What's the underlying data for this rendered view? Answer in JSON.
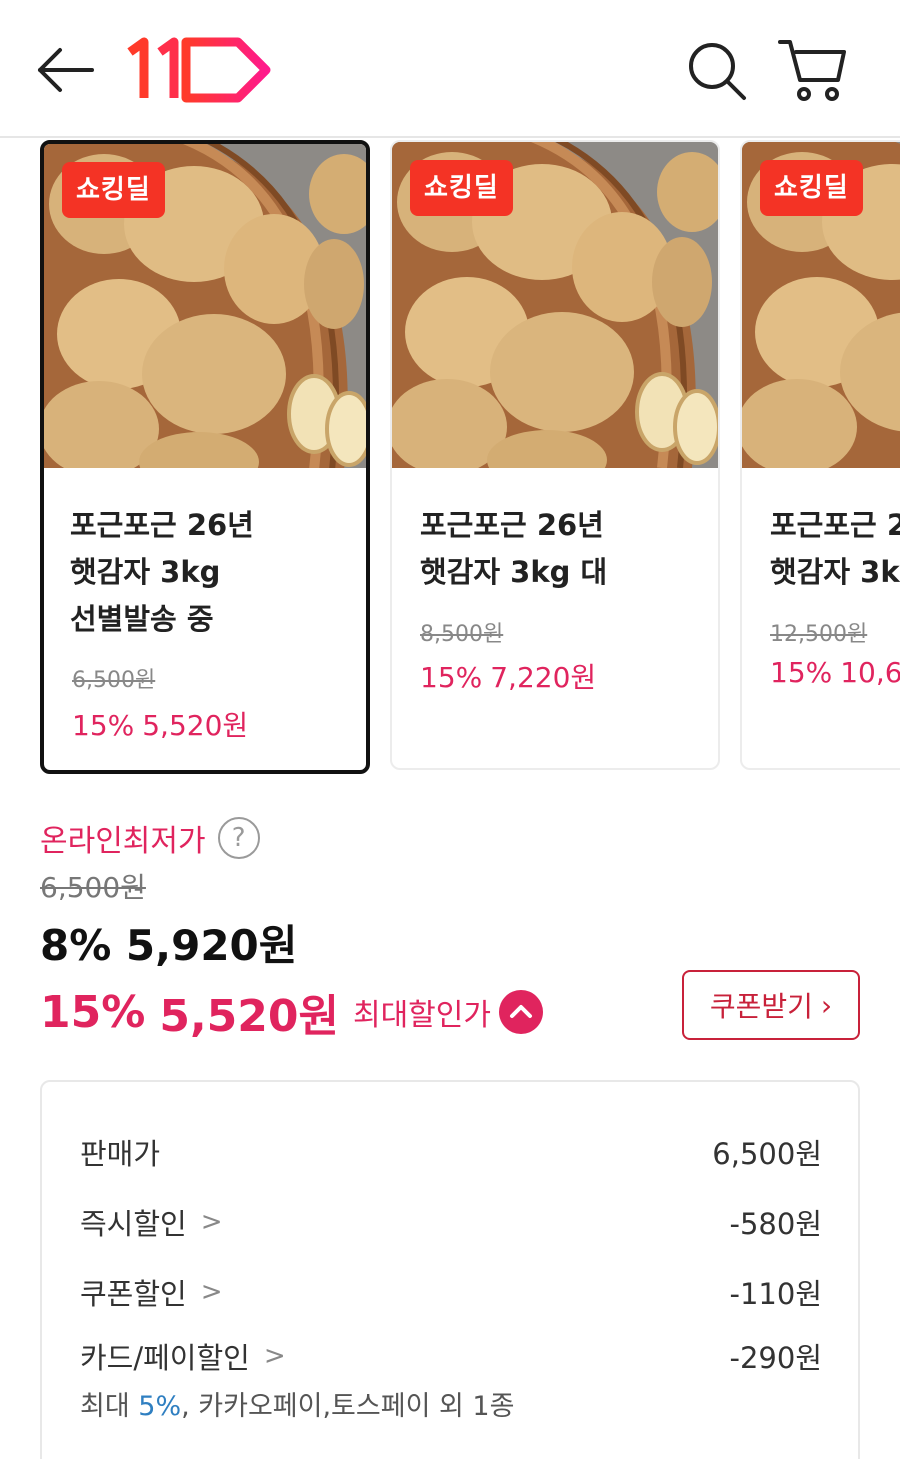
{
  "header": {
    "back_icon": "arrow-left-icon",
    "logo": "11번가 logo",
    "search_icon": "search-icon",
    "cart_icon": "cart-icon"
  },
  "products": [
    {
      "badge": "쇼킹딜",
      "name": "포근포근 26년\n햇감자 3kg\n선별발송 중",
      "original_price": "6,500원",
      "discount_pct": "15%",
      "price": "5,520원",
      "selected": true
    },
    {
      "badge": "쇼킹딜",
      "name": "포근포근 26년\n햇감자 3kg 대",
      "original_price": "8,500원",
      "discount_pct": "15%",
      "price": "7,220원",
      "selected": false
    },
    {
      "badge": "쇼킹딜",
      "name": "포근포근 2\n햇감자 3k",
      "original_price": "12,500원",
      "discount_pct": "15%",
      "price": "10,6",
      "selected": false
    }
  ],
  "pricing": {
    "lowest_label": "온라인최저가",
    "help": "?",
    "original": "6,500원",
    "sale": "8% 5,920원",
    "max_pct": "15%",
    "max_amount": "5,520원",
    "max_label": "최대할인가",
    "coupon_button": "쿠폰받기",
    "coupon_chevron": "›"
  },
  "breakdown": {
    "rows": [
      {
        "label": "판매가",
        "value": "6,500원",
        "has_chevron": false
      },
      {
        "label": "즉시할인",
        "value": "-580원",
        "has_chevron": true
      },
      {
        "label": "쿠폰할인",
        "value": "-110원",
        "has_chevron": true
      },
      {
        "label": "카드/페이할인",
        "value": "-290원",
        "has_chevron": true
      }
    ],
    "chevron": ">",
    "card_note_prefix": "최대 ",
    "card_note_pct": "5%",
    "card_note_suffix": ", 카카오페이,토스페이 외 1종"
  },
  "colors": {
    "accent": "#e0245e",
    "badge": "#f43325",
    "coupon_border": "#c8213a",
    "link_blue": "#2f7fc1"
  }
}
